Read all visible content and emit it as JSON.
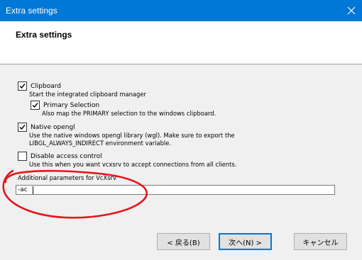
{
  "window": {
    "title": "Extra settings",
    "close_glyph": "✕"
  },
  "header": {
    "title": "Extra settings"
  },
  "options": {
    "clipboard": {
      "label": "Clipboard",
      "description": "Start the integrated clipboard manager",
      "checked": true
    },
    "primary_selection": {
      "label": "Primary Selection",
      "description": "Also map the PRIMARY selection to the windows clipboard.",
      "checked": true
    },
    "native_opengl": {
      "label": "Native opengl",
      "description_line1": "Use the native windows opengl library (wgl). Make sure to export the",
      "description_line2": "LIBGL_ALWAYS_INDIRECT environment variable.",
      "checked": true
    },
    "disable_access_control": {
      "label": "Disable access control",
      "description": "Use this when you want vcxsrv to accept connections from all clients.",
      "checked": false
    }
  },
  "additional_params": {
    "label": "Additional parameters for VcXsrv",
    "value": "-ac"
  },
  "buttons": {
    "back": "< 戻る(B)",
    "next": "次へ(N) >",
    "cancel": "キャンセル"
  },
  "annotation_color": "#e8131b",
  "accent_color": "#0078d7"
}
